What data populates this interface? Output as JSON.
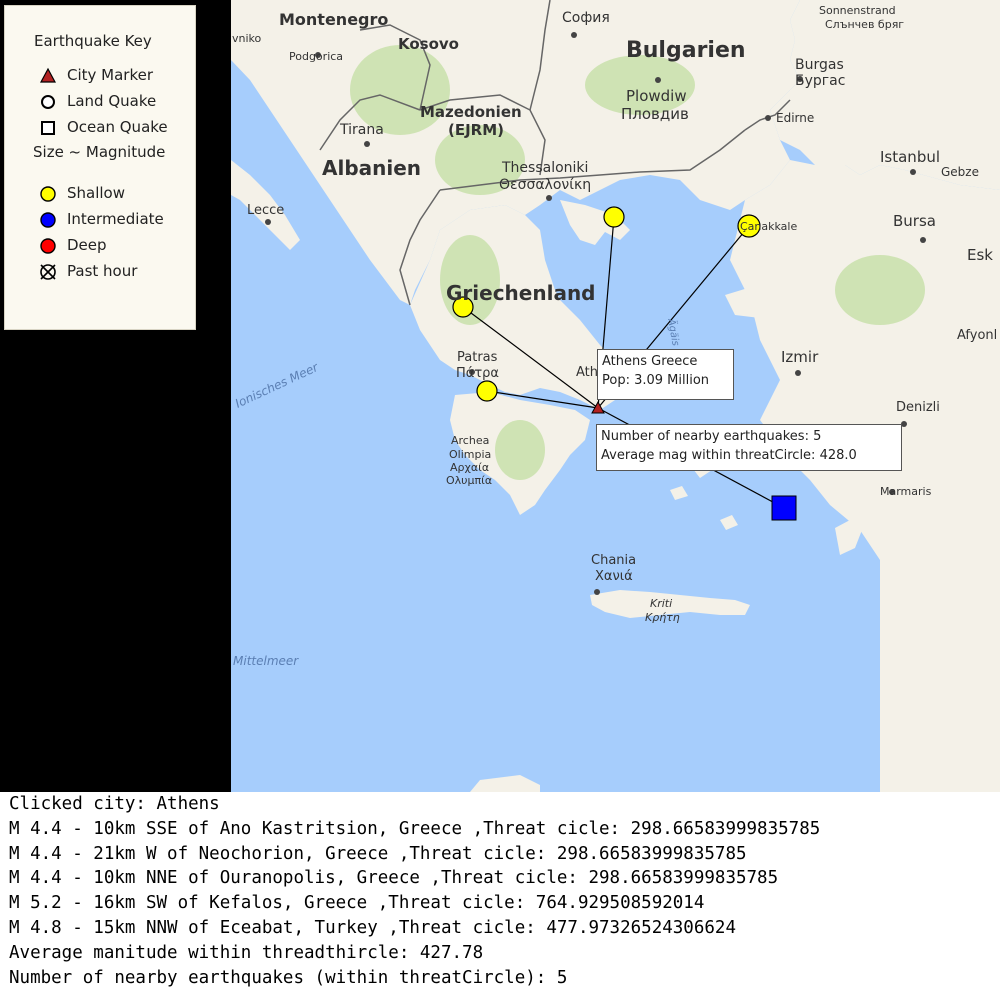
{
  "key": {
    "title": "Earthquake Key",
    "items": [
      {
        "label": "City Marker",
        "icon": "triangle-icon"
      },
      {
        "label": "Land Quake",
        "icon": "circle-icon"
      },
      {
        "label": "Ocean Quake",
        "icon": "square-icon"
      }
    ],
    "size_note": "Size ~ Magnitude",
    "depth": [
      {
        "label": "Shallow",
        "color": "#ffff00"
      },
      {
        "label": "Intermediate",
        "color": "#0000ff"
      },
      {
        "label": "Deep",
        "color": "#ff0000"
      }
    ],
    "past_hour_label": "Past hour"
  },
  "map_labels": {
    "montenegro": "Montenegro",
    "kosovo": "Kosovo",
    "sofia": "София",
    "bulgarien": "Bulgarien",
    "podgorica": "Podgorica",
    "mazedonien": "Mazedonien",
    "ejrm": "(EJRM)",
    "tirana": "Tirana",
    "albanien": "Albanien",
    "plowdiw": "Plowdiw",
    "plovdiv": "Пловдив",
    "burgas": "Burgas",
    "burgas_cyr": "Бургас",
    "sonnenstrand": "Sonnenstrand",
    "sonnenstrand_cyr": "Слънчев бряг",
    "edirne": "Edirne",
    "thessaloniki": "Thessaloniki",
    "thessaloniki_gr": "Θεσσαλονίκη",
    "istanbul": "Istanbul",
    "gebze": "Gebze",
    "lecce": "Lecce",
    "canakkale": "Çanakkale",
    "bursa": "Bursa",
    "esk": "Esk",
    "griechenland": "Griechenland",
    "patras": "Patras",
    "patras_gr": "Πάτρα",
    "izmir": "Izmir",
    "afyon": "Afyonl",
    "ionisches": "Ionisches Meer",
    "agais": "Ägäis",
    "ath": "Ath",
    "archea": "Archea",
    "olimpia": "Olimpia",
    "archaia": "Αρχαία",
    "olympia": "Ολυμπία",
    "denizli": "Denizli",
    "marmaris": "Marmaris",
    "chania": "Chania",
    "chania_gr": "Χανιά",
    "kriti": "Kriti",
    "kriti_gr": "Κρήτη",
    "mittelmeer": "Mittelmeer",
    "vniko": "vniko"
  },
  "colors": {
    "sea": "#a6cdfc",
    "land": "#f4f1e8",
    "forest": "#cfe3b4",
    "border": "#666666",
    "quake_shallow": "#ffff00",
    "quake_intermediate": "#0000ff",
    "city_marker": "#b22222"
  },
  "tooltips": {
    "city_line1": "Athens Greece",
    "city_line2": "Pop: 3.09 Million",
    "threat_line1": "Number of nearby earthquakes: 5",
    "threat_line2": "Average mag within threatCircle: 428.0"
  },
  "console": {
    "lines": [
      "Clicked city: Athens",
      "M 4.4 - 10km SSE of Ano Kastritsion, Greece ,Threat cicle: 298.66583999835785",
      "M 4.4 - 21km W of Neochorion, Greece ,Threat cicle: 298.66583999835785",
      "M 4.4 - 10km NNE of Ouranopolis, Greece ,Threat cicle: 298.66583999835785",
      "M 5.2 - 16km SW of Kefalos, Greece ,Threat cicle: 764.929508592014",
      "M 4.8 - 15km NNW of Eceabat, Turkey ,Threat cicle: 477.97326524306624",
      "Average manitude within threadthircle: 427.78",
      "Number of nearby earthquakes (within threatCircle): 5"
    ]
  }
}
